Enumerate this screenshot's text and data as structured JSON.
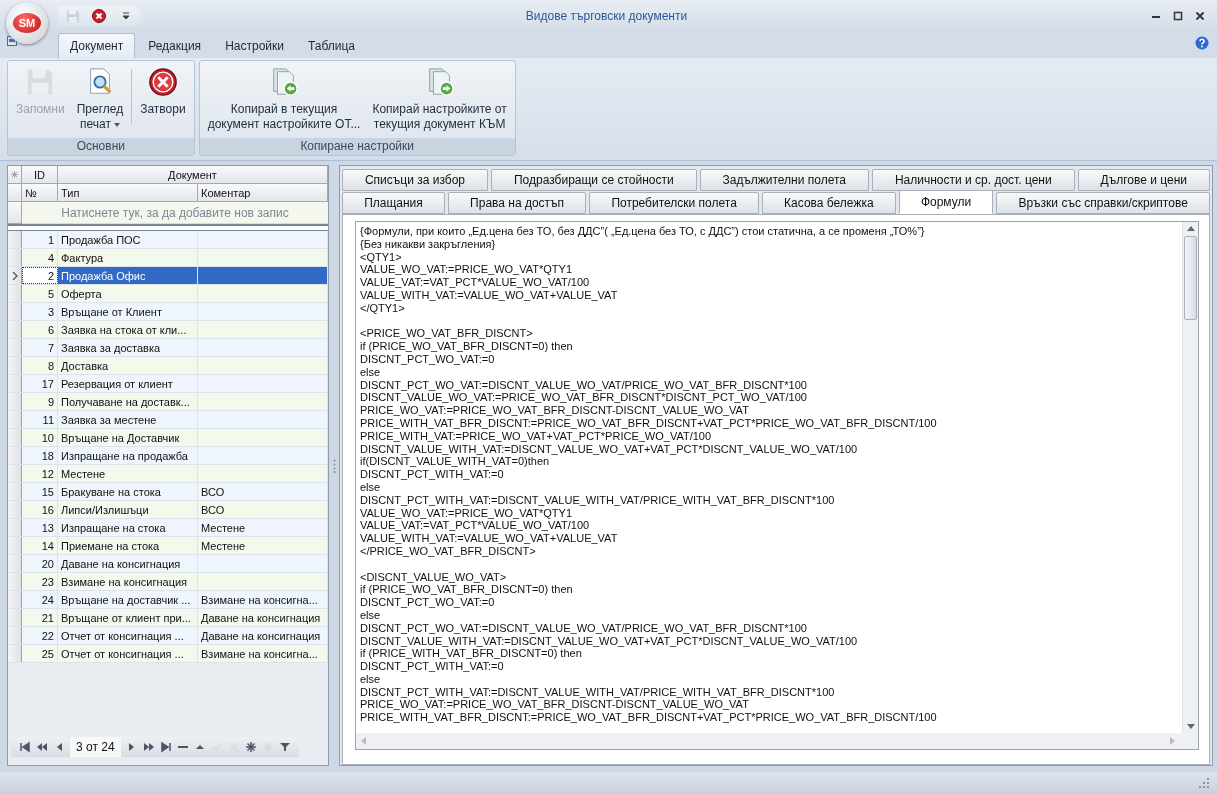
{
  "window": {
    "title": "Видове търговски документи"
  },
  "app_logo": "SM",
  "quick_access": [
    {
      "kind": "save",
      "disabled": true
    },
    {
      "kind": "close",
      "disabled": false
    }
  ],
  "ribbon_tabs": [
    {
      "label": "Документ",
      "selected": true
    },
    {
      "label": "Редакция",
      "selected": false
    },
    {
      "label": "Настройки",
      "selected": false
    },
    {
      "label": "Таблица",
      "selected": false
    }
  ],
  "ribbon_groups": [
    {
      "label": "Основни",
      "buttons": [
        {
          "label": "Запомни",
          "kind": "save",
          "disabled": true,
          "dropdown": false
        },
        {
          "label": "Преглед\nпечат",
          "kind": "preview",
          "disabled": false,
          "dropdown": true
        },
        {
          "label": "Затвори",
          "kind": "close",
          "disabled": false,
          "dropdown": false
        }
      ]
    },
    {
      "label": "Копиране настройки",
      "buttons": [
        {
          "label": "Копирай в текущия\nдокумент настройките ОТ...",
          "kind": "copy-in",
          "disabled": false,
          "dropdown": false
        },
        {
          "label": "Копирай настройките от\nтекущия документ КЪМ",
          "kind": "copy-out",
          "disabled": false,
          "dropdown": false
        }
      ]
    }
  ],
  "grid": {
    "band_headers": [
      "ID",
      "Документ"
    ],
    "columns": [
      "№",
      "Тип",
      "Коментар"
    ],
    "new_row_hint": "Натиснете тук, за да добавите нов запис",
    "rows": [
      {
        "id": "1",
        "type": "Продажба ПОС",
        "comment": "",
        "selected": false
      },
      {
        "id": "4",
        "type": "Фактура",
        "comment": "",
        "selected": false
      },
      {
        "id": "2",
        "type": "Продажба Офис",
        "comment": "",
        "selected": true
      },
      {
        "id": "5",
        "type": "Оферта",
        "comment": "",
        "selected": false
      },
      {
        "id": "3",
        "type": "Връщане от Клиент",
        "comment": "",
        "selected": false
      },
      {
        "id": "6",
        "type": "Заявка на стока от кли...",
        "comment": "",
        "selected": false
      },
      {
        "id": "7",
        "type": "Заявка за доставка",
        "comment": "",
        "selected": false
      },
      {
        "id": "8",
        "type": "Доставка",
        "comment": "",
        "selected": false
      },
      {
        "id": "17",
        "type": "Резервация от клиент",
        "comment": "",
        "selected": false
      },
      {
        "id": "9",
        "type": "Получаване на доставк...",
        "comment": "",
        "selected": false
      },
      {
        "id": "11",
        "type": "Заявка за местене",
        "comment": "",
        "selected": false
      },
      {
        "id": "10",
        "type": "Връщане на Доставчик",
        "comment": "",
        "selected": false
      },
      {
        "id": "18",
        "type": "Изпращане на продажба",
        "comment": "",
        "selected": false
      },
      {
        "id": "12",
        "type": "Местене",
        "comment": "",
        "selected": false
      },
      {
        "id": "15",
        "type": "Бракуване на стока",
        "comment": "ВСО",
        "selected": false
      },
      {
        "id": "16",
        "type": "Липси/Излишъци",
        "comment": "ВСО",
        "selected": false
      },
      {
        "id": "13",
        "type": "Изпращане на стока",
        "comment": "Местене",
        "selected": false
      },
      {
        "id": "14",
        "type": "Приемане на стока",
        "comment": "Местене",
        "selected": false
      },
      {
        "id": "20",
        "type": "Даване на консигнация",
        "comment": "",
        "selected": false
      },
      {
        "id": "23",
        "type": "Взимане на консигнация",
        "comment": "",
        "selected": false
      },
      {
        "id": "24",
        "type": "Връщане на доставчик ...",
        "comment": "Взимане на консигна...",
        "selected": false
      },
      {
        "id": "21",
        "type": "Връщане от клиент при...",
        "comment": "Даване на консигнация",
        "selected": false
      },
      {
        "id": "22",
        "type": "Отчет от консигнация ...",
        "comment": "Даване на консигнация",
        "selected": false
      },
      {
        "id": "25",
        "type": "Отчет от консигнация ...",
        "comment": "Взимане на консигна...",
        "selected": false
      }
    ],
    "navigator": {
      "position": "3 от 24",
      "buttons": [
        {
          "kind": "first",
          "disabled": false
        },
        {
          "kind": "prev-page",
          "disabled": false
        },
        {
          "kind": "prev",
          "disabled": false
        },
        {
          "kind": "position"
        },
        {
          "kind": "next",
          "disabled": false
        },
        {
          "kind": "next-page",
          "disabled": false
        },
        {
          "kind": "last",
          "disabled": false
        },
        {
          "kind": "delete",
          "disabled": false
        },
        {
          "kind": "edit",
          "disabled": false
        },
        {
          "kind": "save",
          "disabled": true
        },
        {
          "kind": "cancel",
          "disabled": true
        },
        {
          "kind": "add",
          "disabled": false
        },
        {
          "kind": "add-child",
          "disabled": true
        },
        {
          "kind": "filter",
          "disabled": false
        }
      ]
    }
  },
  "settings_tabs": [
    [
      {
        "label": "Списъци за избор",
        "selected": false
      },
      {
        "label": "Подразбиращи се стойности",
        "selected": false
      },
      {
        "label": "Задължителни полета",
        "selected": false
      },
      {
        "label": "Наличности и ср. дост. цени",
        "selected": false
      },
      {
        "label": "Дългове и цени",
        "selected": false
      }
    ],
    [
      {
        "label": "Плащания",
        "selected": false
      },
      {
        "label": "Права на достъп",
        "selected": false
      },
      {
        "label": "Потребителски полета",
        "selected": false
      },
      {
        "label": "Касова бележка",
        "selected": false
      },
      {
        "label": "Формули",
        "selected": true
      },
      {
        "label": "Връзки със справки/скриптове",
        "selected": false
      }
    ]
  ],
  "formulas_text": "{Формули, при които „Ед.цена без ТО, без ДДС”( „Ед.цена без ТО, с ДДС”) стои статична, а се променя „ТО%”}\n{Без никакви закръгления}\n<QTY1>\nVALUE_WO_VAT:=PRICE_WO_VAT*QTY1\nVALUE_VAT:=VAT_PCT*VALUE_WO_VAT/100\nVALUE_WITH_VAT:=VALUE_WO_VAT+VALUE_VAT\n</QTY1>\n\n<PRICE_WO_VAT_BFR_DISCNT>\nif (PRICE_WO_VAT_BFR_DISCNT=0) then\nDISCNT_PCT_WO_VAT:=0\nelse\nDISCNT_PCT_WO_VAT:=DISCNT_VALUE_WO_VAT/PRICE_WO_VAT_BFR_DISCNT*100\nDISCNT_VALUE_WO_VAT:=PRICE_WO_VAT_BFR_DISCNT*DISCNT_PCT_WO_VAT/100\nPRICE_WO_VAT:=PRICE_WO_VAT_BFR_DISCNT-DISCNT_VALUE_WO_VAT\nPRICE_WITH_VAT_BFR_DISCNT:=PRICE_WO_VAT_BFR_DISCNT+VAT_PCT*PRICE_WO_VAT_BFR_DISCNT/100\nPRICE_WITH_VAT:=PRICE_WO_VAT+VAT_PCT*PRICE_WO_VAT/100\nDISCNT_VALUE_WITH_VAT:=DISCNT_VALUE_WO_VAT+VAT_PCT*DISCNT_VALUE_WO_VAT/100\nif(DISCNT_VALUE_WITH_VAT=0)then\nDISCNT_PCT_WITH_VAT:=0\nelse\nDISCNT_PCT_WITH_VAT:=DISCNT_VALUE_WITH_VAT/PRICE_WITH_VAT_BFR_DISCNT*100\nVALUE_WO_VAT:=PRICE_WO_VAT*QTY1\nVALUE_VAT:=VAT_PCT*VALUE_WO_VAT/100\nVALUE_WITH_VAT:=VALUE_WO_VAT+VALUE_VAT\n</PRICE_WO_VAT_BFR_DISCNT>\n\n<DISCNT_VALUE_WO_VAT>\nif (PRICE_WO_VAT_BFR_DISCNT=0) then\nDISCNT_PCT_WO_VAT:=0\nelse\nDISCNT_PCT_WO_VAT:=DISCNT_VALUE_WO_VAT/PRICE_WO_VAT_BFR_DISCNT*100\nDISCNT_VALUE_WITH_VAT:=DISCNT_VALUE_WO_VAT+VAT_PCT*DISCNT_VALUE_WO_VAT/100\nif (PRICE_WITH_VAT_BFR_DISCNT=0) then\nDISCNT_PCT_WITH_VAT:=0\nelse\nDISCNT_PCT_WITH_VAT:=DISCNT_VALUE_WITH_VAT/PRICE_WITH_VAT_BFR_DISCNT*100\nPRICE_WO_VAT:=PRICE_WO_VAT_BFR_DISCNT-DISCNT_VALUE_WO_VAT\nPRICE_WITH_VAT_BFR_DISCNT:=PRICE_WO_VAT_BFR_DISCNT+VAT_PCT*PRICE_WO_VAT_BFR_DISCNT/100"
}
